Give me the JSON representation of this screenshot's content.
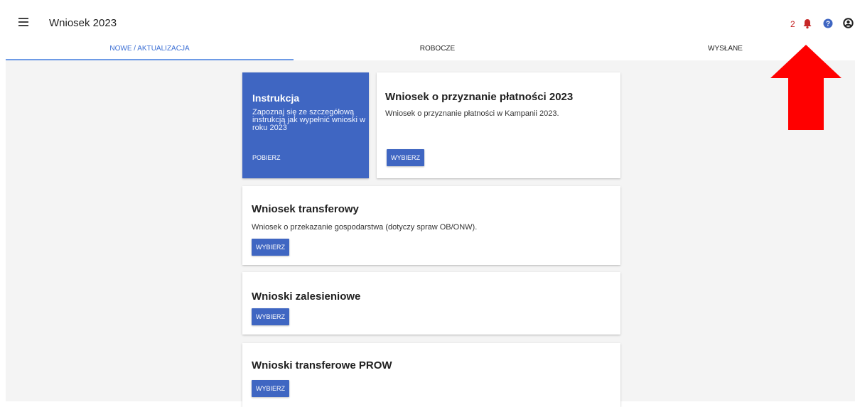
{
  "header": {
    "title": "Wniosek 2023",
    "notification_count": "2",
    "icons": [
      "menu-icon",
      "bell-icon",
      "help-icon",
      "account-icon"
    ]
  },
  "tabs": [
    {
      "label": "NOWE / AKTUALIZACJA",
      "active": true
    },
    {
      "label": "ROBOCZE",
      "active": false
    },
    {
      "label": "WYSŁANE",
      "active": false
    }
  ],
  "instruction_card": {
    "title": "Instrukcja",
    "description": "Zapoznaj się ze szczegółową instrukcją jak wypełnić wnioski w roku 2023",
    "action": "POBIERZ"
  },
  "cards": [
    {
      "title": "Wniosek o przyznanie płatności 2023",
      "description": "Wniosek o przyznanie płatności w Kampanii 2023.",
      "action": "WYBIERZ"
    },
    {
      "title": "Wniosek transferowy",
      "description": "Wniosek o przekazanie gospodarstwa (dotyczy spraw OB/ONW).",
      "action": "WYBIERZ"
    },
    {
      "title": "Wnioski zalesieniowe",
      "description": "",
      "action": "WYBIERZ"
    },
    {
      "title": "Wnioski transferowe PROW",
      "description": "",
      "action": "WYBIERZ"
    }
  ],
  "colors": {
    "primary": "#3f66c2",
    "active_tab": "#3a6ed4",
    "notification": "#c62828",
    "arrow": "#ff0000"
  }
}
